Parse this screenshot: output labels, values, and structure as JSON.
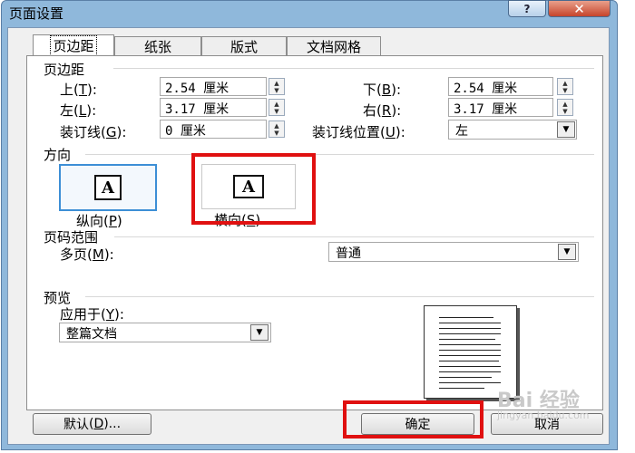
{
  "window": {
    "title": "页面设置",
    "help_glyph": "?",
    "close_glyph": "✕"
  },
  "tabs": [
    "页边距",
    "纸张",
    "版式",
    "文档网格"
  ],
  "margins": {
    "group_title": "页边距",
    "top": {
      "label": "上",
      "key": "T",
      "value": "2.54 厘米"
    },
    "bottom": {
      "label": "下",
      "key": "B",
      "value": "2.54 厘米"
    },
    "left": {
      "label": "左",
      "key": "L",
      "value": "3.17 厘米"
    },
    "right": {
      "label": "右",
      "key": "R",
      "value": "3.17 厘米"
    },
    "gutter": {
      "label": "装订线",
      "key": "G",
      "value": "0 厘米"
    },
    "gutter_pos": {
      "label": "装订线位置",
      "key": "U",
      "value": "左"
    }
  },
  "orientation": {
    "group_title": "方向",
    "portrait": {
      "label": "纵向",
      "key": "P",
      "icon_glyph": "A"
    },
    "landscape": {
      "label": "横向",
      "key": "S",
      "icon_glyph": "A"
    }
  },
  "pages": {
    "group_title": "页码范围",
    "multi": {
      "label": "多页",
      "key": "M",
      "value": "普通"
    }
  },
  "preview": {
    "group_title": "预览",
    "apply_label": "应用于",
    "apply_key": "Y",
    "apply_value": "整篇文档"
  },
  "buttons": {
    "default": "默认",
    "default_key": "D",
    "ok": "确定",
    "cancel": "取消"
  },
  "watermark": {
    "logo": "Bai 经验",
    "url": "jingyan.baidu.com"
  },
  "colors": {
    "highlight": "#e01010",
    "frame": "#8fb8db",
    "selected_border": "#3d8fd6"
  }
}
